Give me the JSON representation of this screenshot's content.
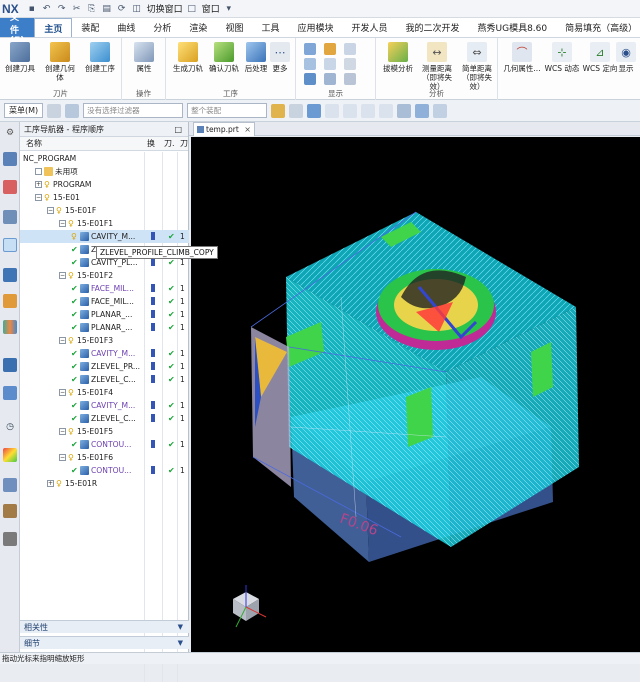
{
  "app": {
    "logo": "NX",
    "quick_access": [
      "切换窗口",
      "窗口"
    ]
  },
  "menu": {
    "file": "文件(F)",
    "tabs": [
      "主页",
      "装配",
      "曲线",
      "分析",
      "渲染",
      "视图",
      "工具",
      "应用模块",
      "开发人员",
      "我的二次开发",
      "燕秀UG模具8.60",
      "简易填充（高级）"
    ],
    "active_tab": "主页"
  },
  "ribbon": {
    "buttons": {
      "create_tool": "创建刀具",
      "create_geometry": "创建几何体",
      "create_operation": "创建工序",
      "properties": "属性",
      "generate_toolpath": "生成刀轨",
      "verify_toolpath": "确认刀轨",
      "postprocess": "后处理",
      "more": "更多",
      "draft_analysis": "拔模分析",
      "measure_distance": "测量距离（即将失效）",
      "simple_distance": "简单距离（即将失效）",
      "geom_properties": "几何属性...",
      "wcs_dynamic": "WCS 动态",
      "wcs_orient": "WCS 定向",
      "show": "显示"
    },
    "groups": {
      "inserts": "刀片",
      "operations": "操作",
      "process": "工序",
      "display": "显示",
      "analysis": "分析"
    }
  },
  "toolbar": {
    "menu": "菜单(M)",
    "filter_placeholder": "没有选择过滤器",
    "assembly_placeholder": "整个装配"
  },
  "navigator": {
    "title": "工序导航器 - 程序顺序",
    "col_name": "名称",
    "col_change": "换",
    "col_tool": "刀.",
    "col_path": "刀",
    "rows": [
      {
        "label": "NC_PROGRAM",
        "indent": 0,
        "kind": "root"
      },
      {
        "label": "未用项",
        "indent": 1,
        "kind": "folder",
        "exp": ""
      },
      {
        "label": "PROGRAM",
        "indent": 1,
        "kind": "program",
        "exp": "+"
      },
      {
        "label": "15-E01",
        "indent": 1,
        "kind": "program",
        "exp": "-"
      },
      {
        "label": "15-E01F",
        "indent": 2,
        "kind": "program",
        "exp": "-"
      },
      {
        "label": "15-E01F1",
        "indent": 3,
        "kind": "program",
        "exp": "-"
      },
      {
        "label": "CAVITY_M...",
        "indent": 4,
        "kind": "op-sel",
        "color": "#222",
        "path": true,
        "tool": "1"
      },
      {
        "label": "ZLEVEL_PROFILE_CLIMB_COPY",
        "indent": 4,
        "kind": "op",
        "color": "#222",
        "path": false,
        "tool": ""
      },
      {
        "label": "CAVITY_PL...",
        "indent": 4,
        "kind": "op",
        "color": "#222",
        "path": true,
        "tool": "1"
      },
      {
        "label": "15-E01F2",
        "indent": 3,
        "kind": "program",
        "exp": "-"
      },
      {
        "label": "FACE_MIL...",
        "indent": 4,
        "kind": "op",
        "color": "#6b3fb0",
        "path": true,
        "tool": "1"
      },
      {
        "label": "FACE_MIL...",
        "indent": 4,
        "kind": "op",
        "color": "#222",
        "path": true,
        "tool": "1"
      },
      {
        "label": "PLANAR_...",
        "indent": 4,
        "kind": "op",
        "color": "#222",
        "path": true,
        "tool": "1"
      },
      {
        "label": "PLANAR_...",
        "indent": 4,
        "kind": "op",
        "color": "#222",
        "path": true,
        "tool": "1"
      },
      {
        "label": "15-E01F3",
        "indent": 3,
        "kind": "program",
        "exp": "-"
      },
      {
        "label": "CAVITY_M...",
        "indent": 4,
        "kind": "op",
        "color": "#6b3fb0",
        "path": true,
        "tool": "1"
      },
      {
        "label": "ZLEVEL_PR...",
        "indent": 4,
        "kind": "op",
        "color": "#222",
        "path": true,
        "tool": "1"
      },
      {
        "label": "ZLEVEL_C...",
        "indent": 4,
        "kind": "op",
        "color": "#222",
        "path": true,
        "tool": "1"
      },
      {
        "label": "15-E01F4",
        "indent": 3,
        "kind": "program",
        "exp": "-"
      },
      {
        "label": "CAVITY_M...",
        "indent": 4,
        "kind": "op",
        "color": "#6b3fb0",
        "path": true,
        "tool": "1"
      },
      {
        "label": "ZLEVEL_C...",
        "indent": 4,
        "kind": "op",
        "color": "#222",
        "path": true,
        "tool": "1"
      },
      {
        "label": "15-E01F5",
        "indent": 3,
        "kind": "program",
        "exp": "-"
      },
      {
        "label": "CONTOU...",
        "indent": 4,
        "kind": "op",
        "color": "#6b3fb0",
        "path": true,
        "tool": "1"
      },
      {
        "label": "15-E01F6",
        "indent": 3,
        "kind": "program",
        "exp": "-"
      },
      {
        "label": "CONTOU...",
        "indent": 4,
        "kind": "op",
        "color": "#6b3fb0",
        "path": true,
        "tool": "1"
      },
      {
        "label": "15-E01R",
        "indent": 2,
        "kind": "program",
        "exp": "+"
      }
    ],
    "tooltip": "ZLEVEL_PROFILE_CLIMB_COPY"
  },
  "panels": {
    "dependencies": "相关性",
    "details": "细节"
  },
  "document": {
    "tab": "temp.prt"
  },
  "viewport": {
    "dimension_text": "F0.06"
  },
  "status": {
    "message": "拖动光标来指明缩放矩形"
  }
}
